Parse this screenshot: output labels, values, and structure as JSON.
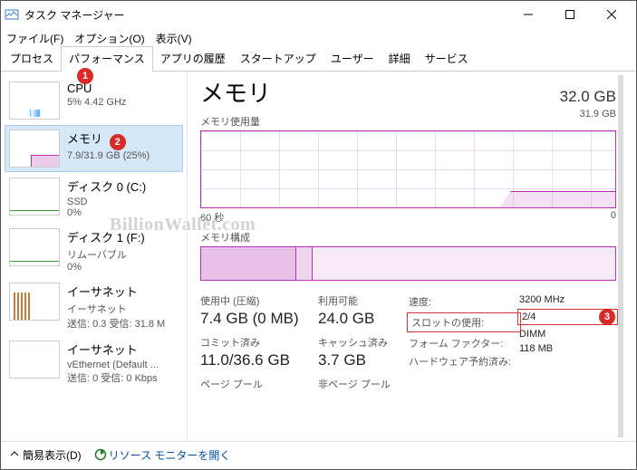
{
  "window": {
    "title": "タスク マネージャー"
  },
  "menu": {
    "file": "ファイル(F)",
    "options": "オプション(O)",
    "view": "表示(V)"
  },
  "tabs": [
    "プロセス",
    "パフォーマンス",
    "アプリの履歴",
    "スタートアップ",
    "ユーザー",
    "詳細",
    "サービス"
  ],
  "sidebar": [
    {
      "title": "CPU",
      "sub": "5%  4.42 GHz",
      "sub2": ""
    },
    {
      "title": "メモリ",
      "sub": "7.9/31.9 GB (25%)",
      "sub2": ""
    },
    {
      "title": "ディスク 0 (C:)",
      "sub": "SSD",
      "sub2": "0%"
    },
    {
      "title": "ディスク 1 (F:)",
      "sub": "リムーバブル",
      "sub2": "0%"
    },
    {
      "title": "イーサネット",
      "sub": "イーサネット",
      "sub2": "送信: 0.3 受信: 31.8 M"
    },
    {
      "title": "イーサネット",
      "sub": "vEthernet (Default ...",
      "sub2": "送信: 0 受信: 0 Kbps"
    }
  ],
  "main": {
    "title": "メモリ",
    "total": "32.0 GB",
    "usage_label": "メモリ使用量",
    "usage_max": "31.9 GB",
    "axis_left": "60 秒",
    "axis_right": "0",
    "comp_label": "メモリ構成",
    "stats": {
      "inuse_label": "使用中 (圧縮)",
      "inuse": "7.4 GB (0 MB)",
      "commit_label": "コミット済み",
      "commit": "11.0/36.6 GB",
      "paged_label": "ページ プール",
      "avail_label": "利用可能",
      "avail": "24.0 GB",
      "cache_label": "キャッシュ済み",
      "cache": "3.7 GB",
      "nonpaged_label": "非ページ プール"
    },
    "props": {
      "speed_l": "速度:",
      "speed_v": "3200 MHz",
      "slots_l": "スロットの使用:",
      "slots_v": "2/4",
      "form_l": "フォーム ファクター:",
      "form_v": "DIMM",
      "hw_l": "ハードウェア予約済み:",
      "hw_v": "118 MB"
    }
  },
  "footer": {
    "brief": "簡易表示(D)",
    "resmon": "リソース モニターを開く"
  },
  "badges": {
    "b1": "1",
    "b2": "2",
    "b3": "3"
  },
  "watermark": "BillionWallet.com",
  "chart_data": {
    "type": "area",
    "title": "メモリ使用量",
    "xlabel": "秒",
    "ylabel": "GB",
    "ylim": [
      0,
      31.9
    ],
    "x_range_seconds": [
      60,
      0
    ],
    "series": [
      {
        "name": "メモリ使用量",
        "approx_recent_value_gb": 7.9
      }
    ],
    "note": "Line flat near ~7.9 GB for the most recent ~15s; earlier portion empty (no data drawn)."
  }
}
